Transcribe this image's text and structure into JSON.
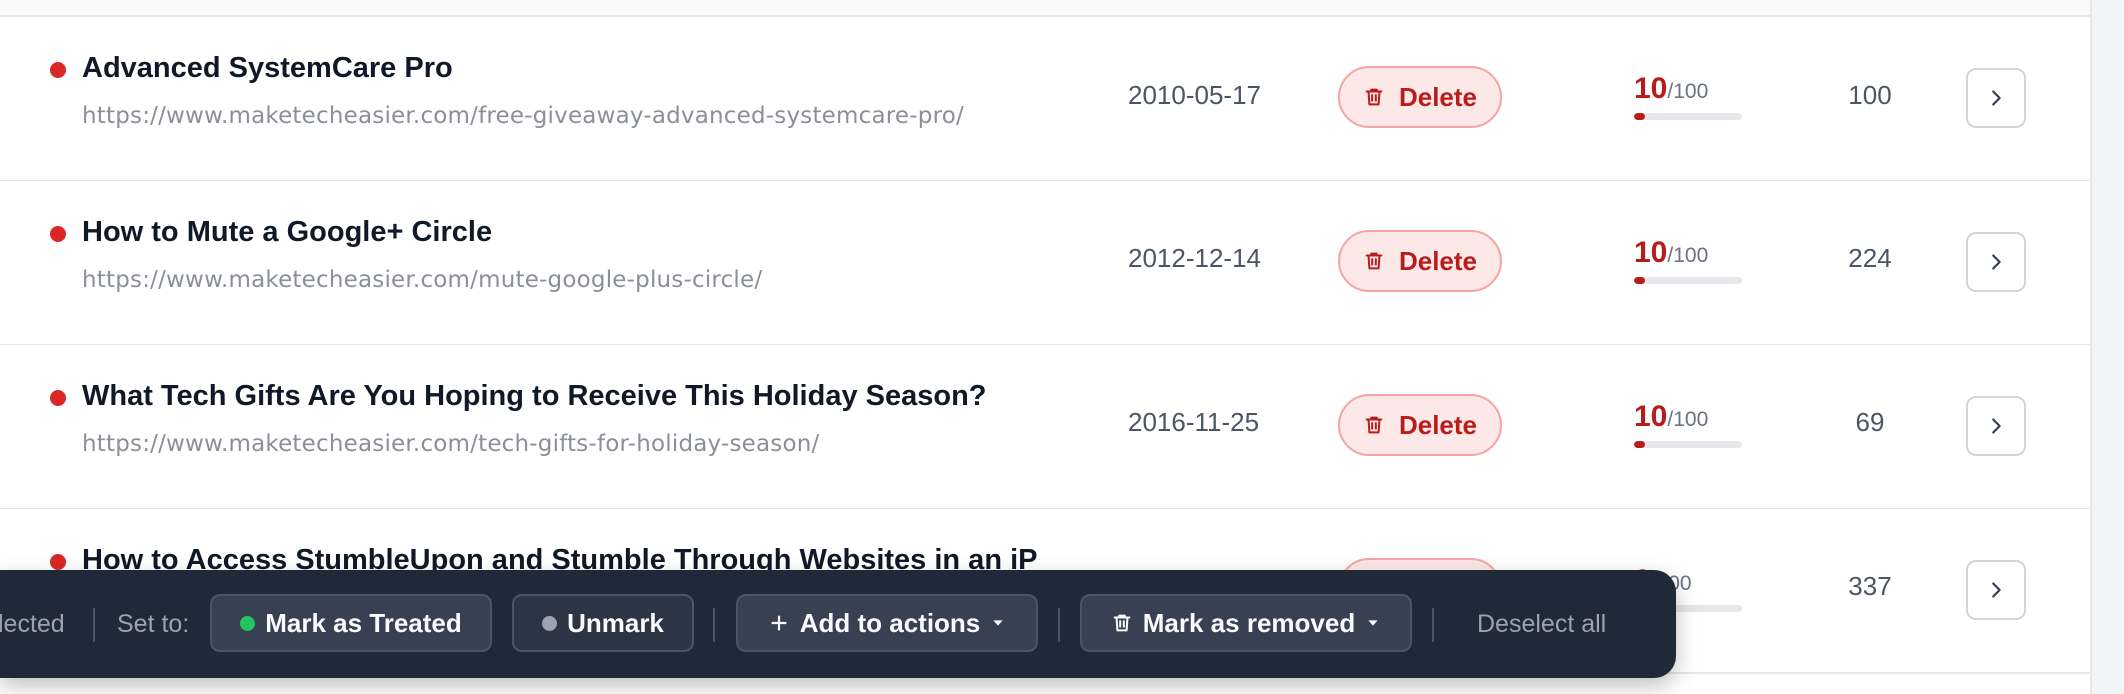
{
  "rows": [
    {
      "title": "Advanced SystemCare Pro",
      "url": "https://www.maketecheasier.com/free-giveaway-advanced-systemcare-pro/",
      "date": "2010-05-17",
      "action": "Delete",
      "score": "10",
      "score_max": "/100",
      "score_fraction": 0.1,
      "count": "100"
    },
    {
      "title": "How to Mute a Google+ Circle",
      "url": "https://www.maketecheasier.com/mute-google-plus-circle/",
      "date": "2012-12-14",
      "action": "Delete",
      "score": "10",
      "score_max": "/100",
      "score_fraction": 0.1,
      "count": "224"
    },
    {
      "title": "What Tech Gifts Are You Hoping to Receive This Holiday Season?",
      "url": "https://www.maketecheasier.com/tech-gifts-for-holiday-season/",
      "date": "2016-11-25",
      "action": "Delete",
      "score": "10",
      "score_max": "/100",
      "score_fraction": 0.1,
      "count": "69"
    },
    {
      "title": "How to Access StumbleUpon and Stumble Through Websites in an iP",
      "score_partial": "0",
      "score_max": "/100",
      "count": "337"
    }
  ],
  "action_bar": {
    "selected_text": "lected",
    "set_to_label": "Set to:",
    "mark_treated": "Mark as Treated",
    "unmark": "Unmark",
    "add_to_actions": "Add to actions",
    "mark_removed": "Mark as removed",
    "deselect_all": "Deselect all"
  },
  "colors": {
    "danger": "#dc2626",
    "danger_text": "#b91c1c",
    "bar_bg": "#1f2937",
    "treated_dot": "#22c55e",
    "unmark_dot": "#9ca3af"
  }
}
